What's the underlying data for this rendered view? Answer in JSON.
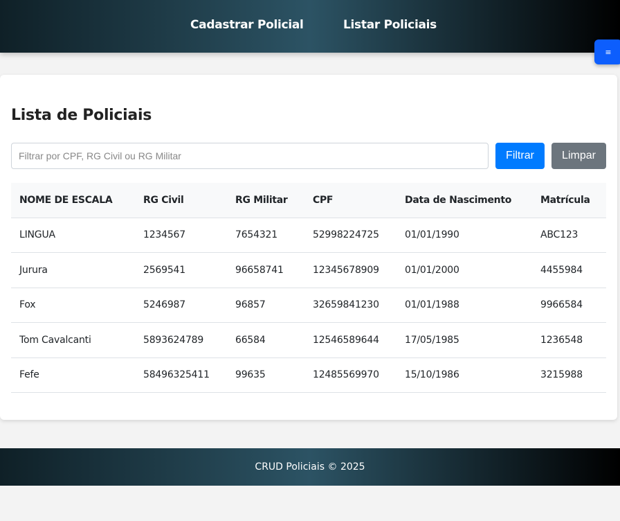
{
  "header": {
    "nav": [
      "Cadastrar Policial",
      "Listar Policiais"
    ],
    "toggle_icon": "menu-icon",
    "toggle_label": "≡"
  },
  "main": {
    "title": "Lista de Policiais",
    "filter": {
      "placeholder": "Filtrar por CPF, RG Civil ou RG Militar",
      "value": "",
      "filter_label": "Filtrar",
      "clear_label": "Limpar"
    },
    "table": {
      "columns": [
        "NOME DE ESCALA",
        "RG Civil",
        "RG Militar",
        "CPF",
        "Data de Nascimento",
        "Matrícula"
      ],
      "rows": [
        [
          "LINGUA",
          "1234567",
          "7654321",
          "52998224725",
          "01/01/1990",
          "ABC123"
        ],
        [
          "Jurura",
          "2569541",
          "96658741",
          "12345678909",
          "01/01/2000",
          "4455984"
        ],
        [
          "Fox",
          "5246987",
          "96857",
          "32659841230",
          "01/01/1988",
          "9966584"
        ],
        [
          "Tom Cavalcanti",
          "5893624789",
          "66584",
          "12546589644",
          "17/05/1985",
          "1236548"
        ],
        [
          "Fefe",
          "58496325411",
          "99635",
          "12485569970",
          "15/10/1986",
          "3215988"
        ]
      ]
    }
  },
  "footer": {
    "text": "CRUD Policiais © 2025"
  },
  "colors": {
    "primary": "#007bff",
    "secondary": "#6c757d",
    "toggle": "#0d5efd",
    "gradient": [
      "#0f2027",
      "#2c5364",
      "#000000"
    ]
  }
}
